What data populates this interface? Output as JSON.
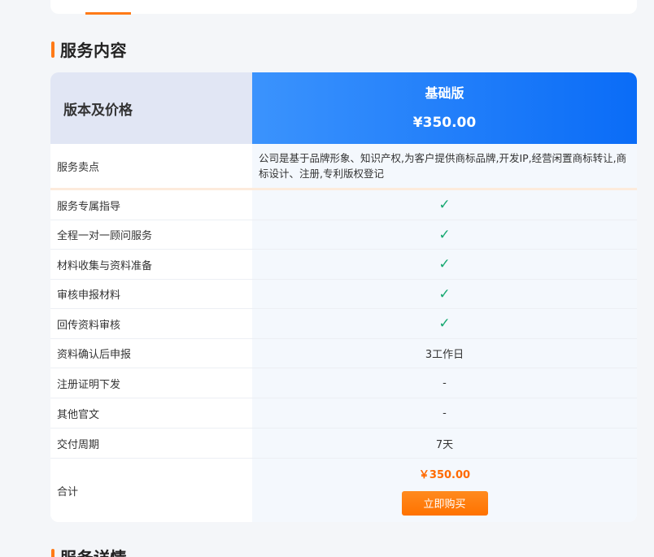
{
  "section_title": "服务内容",
  "next_section_title": "服务详情",
  "table": {
    "header_label": "版本及价格",
    "plan_name": "基础版",
    "plan_price": "¥350.00",
    "rows": [
      {
        "label": "服务卖点",
        "value": "公司是基于品牌形象、知识产权,为客户提供商标品牌,开发IP,经营闲置商标转让,商标设计、注册,专利版权登记"
      },
      {
        "label": "服务专属指导",
        "value": "✓"
      },
      {
        "label": "全程一对一顾问服务",
        "value": "✓"
      },
      {
        "label": "材料收集与资料准备",
        "value": "✓"
      },
      {
        "label": "审核申报材料",
        "value": "✓"
      },
      {
        "label": "回传资料审核",
        "value": "✓"
      },
      {
        "label": "资料确认后申报",
        "value": "3工作日"
      },
      {
        "label": "注册证明下发",
        "value": "-"
      },
      {
        "label": "其他官文",
        "value": "-"
      },
      {
        "label": "交付周期",
        "value": "7天"
      }
    ],
    "total_label": "合计",
    "total_price": "￥350.00",
    "buy_button": "立即购买"
  },
  "colors": {
    "accent": "#ff7a17",
    "header_gradient_start": "#3b93fd",
    "header_gradient_end": "#0a6cf7",
    "check": "#16a870",
    "price": "#ff6a00"
  }
}
